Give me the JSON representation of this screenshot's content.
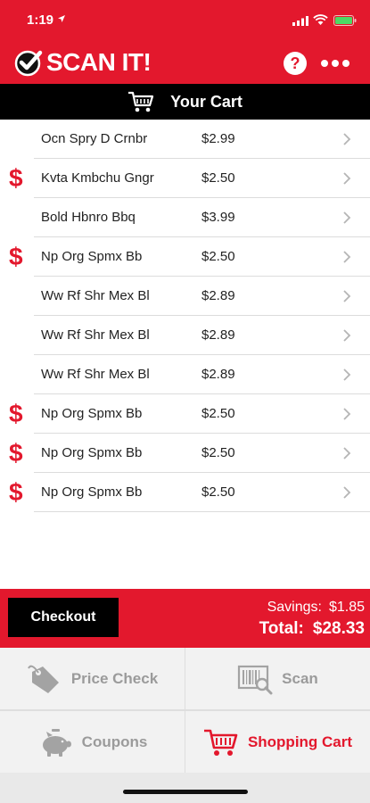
{
  "status_bar": {
    "time": "1:19"
  },
  "header": {
    "app_title": "SCAN IT!",
    "help_symbol": "?"
  },
  "cart_header": {
    "label": "Your Cart"
  },
  "cart": {
    "items": [
      {
        "name": "Ocn Spry D Crnbr",
        "price": "$2.99",
        "sale_marker": ""
      },
      {
        "name": "Kvta Kmbchu Gngr",
        "price": "$2.50",
        "sale_marker": "$"
      },
      {
        "name": "Bold Hbnro Bbq",
        "price": "$3.99",
        "sale_marker": ""
      },
      {
        "name": "Np Org Spmx Bb",
        "price": "$2.50",
        "sale_marker": "$"
      },
      {
        "name": "Ww Rf Shr Mex Bl",
        "price": "$2.89",
        "sale_marker": ""
      },
      {
        "name": "Ww Rf Shr Mex Bl",
        "price": "$2.89",
        "sale_marker": ""
      },
      {
        "name": "Ww Rf Shr Mex Bl",
        "price": "$2.89",
        "sale_marker": ""
      },
      {
        "name": "Np Org Spmx Bb",
        "price": "$2.50",
        "sale_marker": "$"
      },
      {
        "name": "Np Org Spmx Bb",
        "price": "$2.50",
        "sale_marker": "$"
      },
      {
        "name": "Np Org Spmx Bb",
        "price": "$2.50",
        "sale_marker": "$"
      }
    ]
  },
  "checkout": {
    "button_label": "Checkout",
    "savings_label": "Savings:",
    "savings_value": "$1.85",
    "total_label": "Total:",
    "total_value": "$28.33"
  },
  "nav": {
    "price_check": "Price Check",
    "scan": "Scan",
    "coupons": "Coupons",
    "shopping_cart": "Shopping Cart"
  },
  "icons": {
    "sale_marker": "dollar-sign-icon",
    "row_chevron": "chevron-right-icon",
    "cart": "shopping-cart-icon"
  },
  "colors": {
    "brand_red": "#e3182d",
    "cart_bar": "#000000",
    "nav_inactive": "#9b9b9b",
    "battery_green": "#4cd964"
  }
}
